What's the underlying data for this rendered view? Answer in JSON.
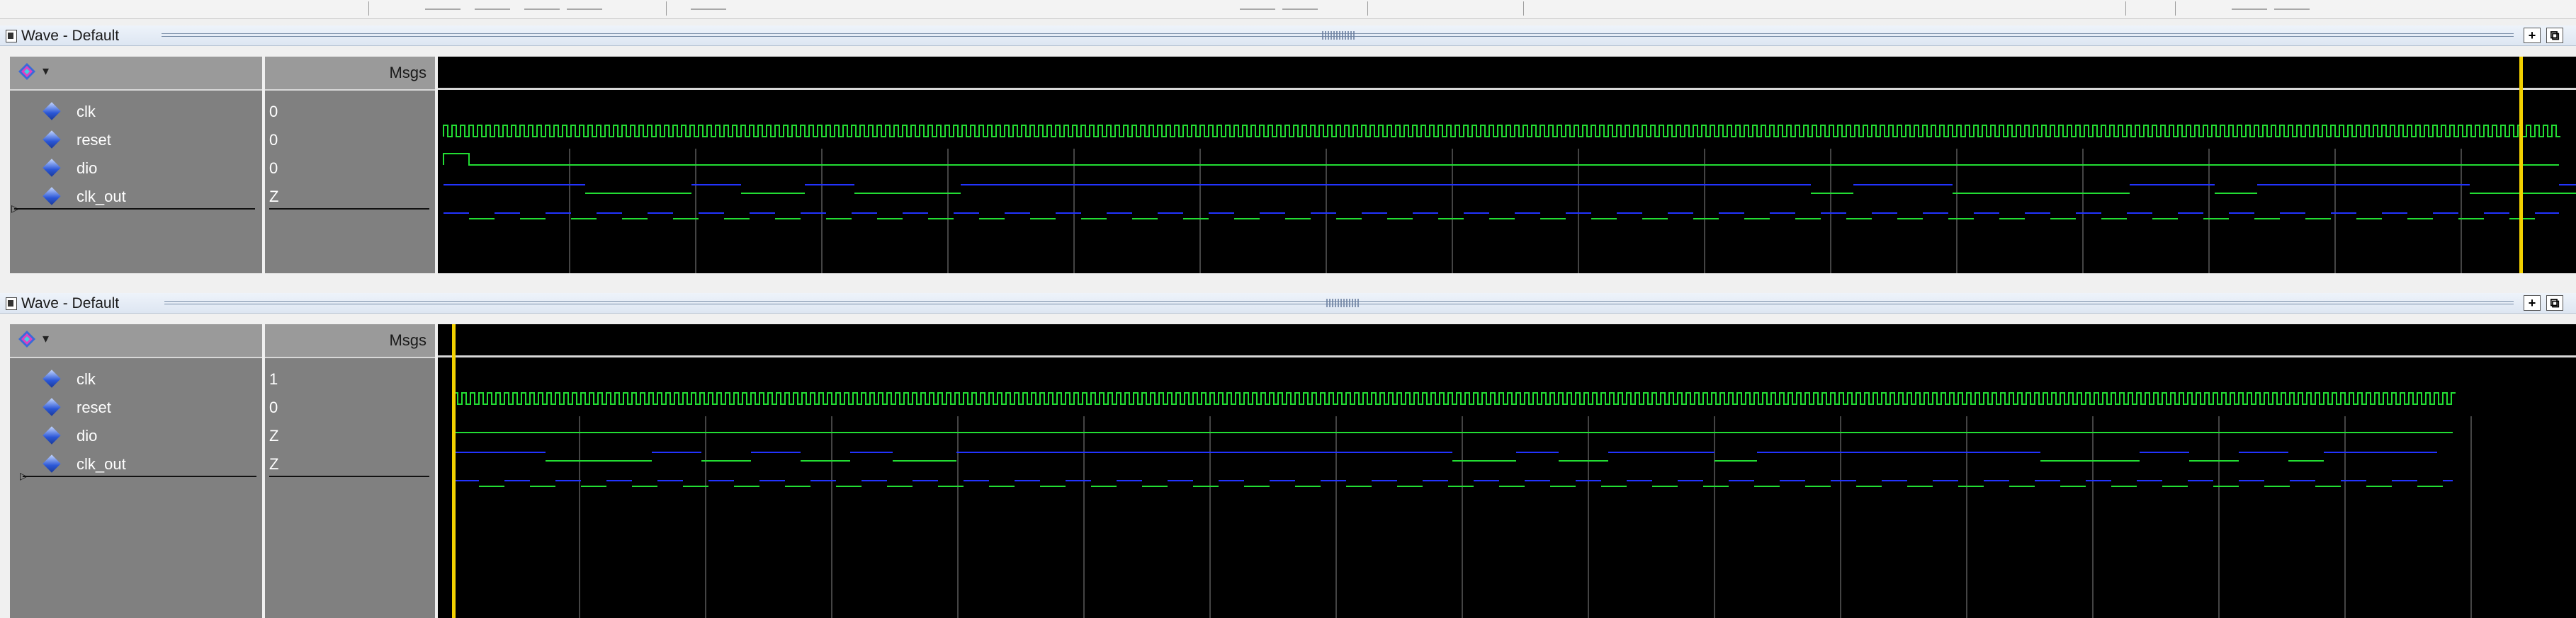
{
  "panes": [
    {
      "title": "Wave - Default",
      "msgs_header": "Msgs",
      "signals": [
        {
          "name": "clk",
          "value": "0"
        },
        {
          "name": "reset",
          "value": "0"
        },
        {
          "name": "dio",
          "value": "0"
        },
        {
          "name": "clk_out",
          "value": "Z"
        }
      ]
    },
    {
      "title": "Wave - Default",
      "msgs_header": "Msgs",
      "signals": [
        {
          "name": "clk",
          "value": "1"
        },
        {
          "name": "reset",
          "value": "0"
        },
        {
          "name": "dio",
          "value": "Z"
        },
        {
          "name": "clk_out",
          "value": "Z"
        }
      ]
    }
  ],
  "titlebar_buttons": {
    "add": "+",
    "undock": "⧉"
  },
  "icons": {
    "window": "wave-window-icon",
    "toolbar": "signal-group-dropdown-icon",
    "signal": "signal-diamond-icon"
  },
  "colors": {
    "wave_bg": "#000000",
    "logic_wave": "#22dd33",
    "highz_wave": "#2233ff",
    "cursor": "#f2d000",
    "gridline": "#5a5a5a"
  }
}
